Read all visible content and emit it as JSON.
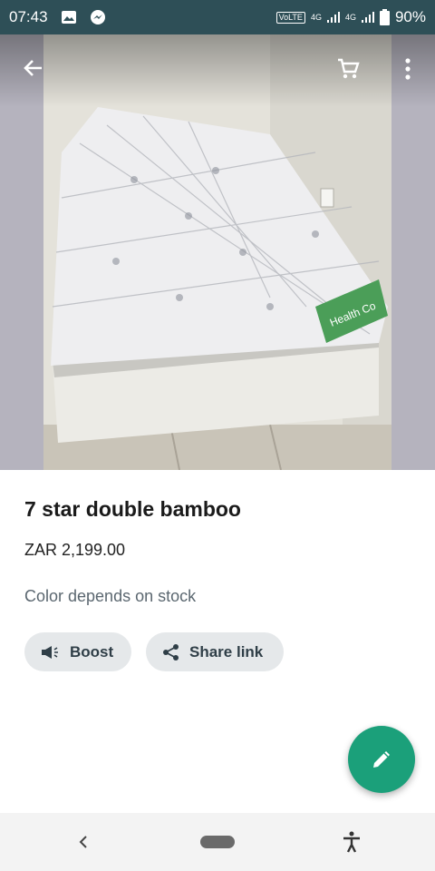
{
  "status_bar": {
    "time": "07:43",
    "volte_label": "VoLTE",
    "network_1": "4G",
    "network_2": "4G",
    "battery": "90%"
  },
  "top_bar": {
    "back_icon": "arrow-left-icon",
    "cart_icon": "cart-icon",
    "menu_icon": "more-vert-icon"
  },
  "product": {
    "title": "7 star double bamboo",
    "price": "ZAR 2,199.00",
    "description": "Color depends on stock",
    "image_label": "Health Co"
  },
  "actions": {
    "boost_label": "Boost",
    "share_label": "Share link"
  },
  "colors": {
    "status_bar": "#2e4f57",
    "fab": "#1ba07a",
    "chip_bg": "#e5e8ea"
  }
}
